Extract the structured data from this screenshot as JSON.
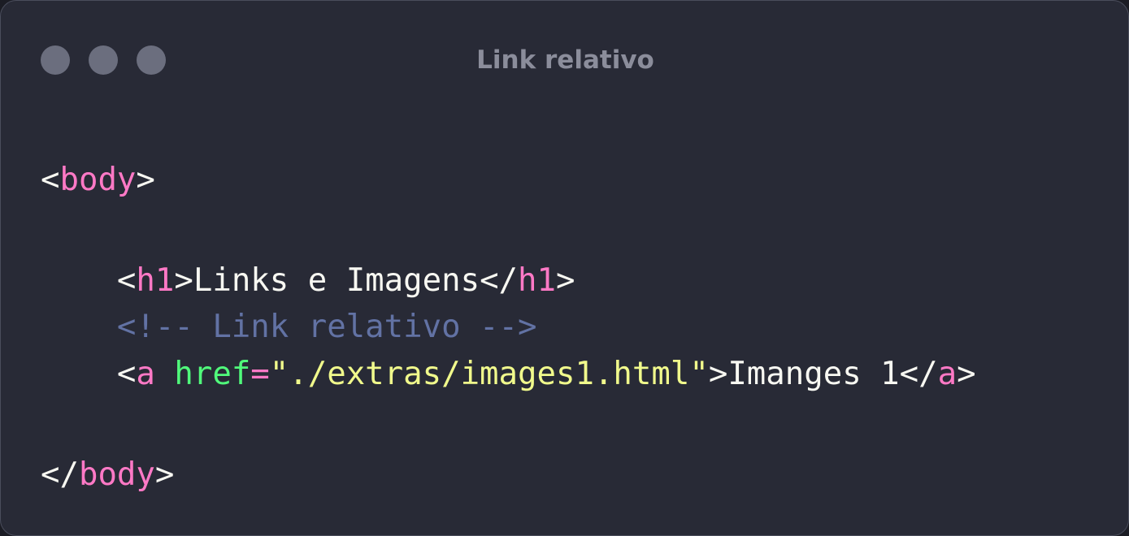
{
  "window": {
    "title": "Link relativo",
    "buttons": [
      "close",
      "minimize",
      "maximize"
    ]
  },
  "code": {
    "line1": {
      "open": "<",
      "tag": "body",
      "close": ">"
    },
    "line3": {
      "open1": "<",
      "tag1": "h1",
      "close1": ">",
      "text": "Links e Imagens",
      "open2": "</",
      "tag2": "h1",
      "close2": ">"
    },
    "line4": {
      "comment": "<!-- Link relativo -->"
    },
    "line5": {
      "open1": "<",
      "tag1": "a",
      "space": " ",
      "attr": "href",
      "eq": "=",
      "value": "\"./extras/images1.html\"",
      "close1": ">",
      "text": "Imanges 1",
      "open2": "</",
      "tag2": "a",
      "close2": ">"
    },
    "line7": {
      "open": "</",
      "tag": "body",
      "close": ">"
    }
  },
  "colors": {
    "background": "#282a36",
    "tag": "#ff79c6",
    "attribute": "#50fa7b",
    "string": "#f1fa8c",
    "comment": "#6272a4",
    "text": "#f8f8f2",
    "window_button": "#6b6e7e",
    "title": "#8b8d9b"
  }
}
